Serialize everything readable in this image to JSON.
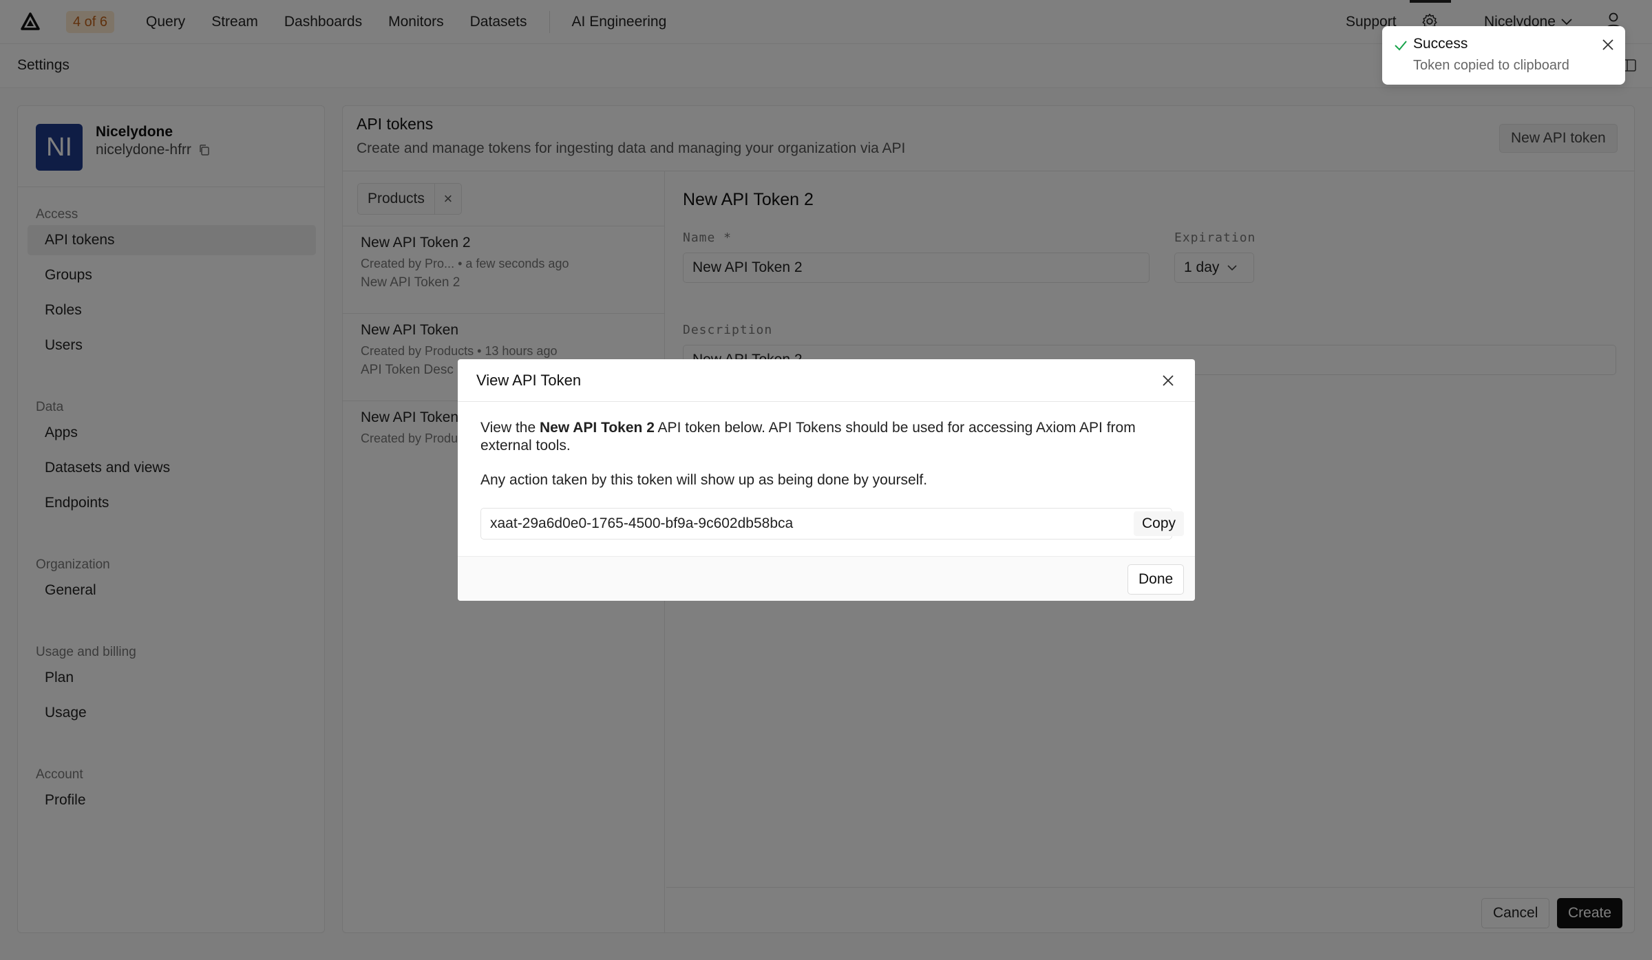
{
  "topbar": {
    "step_badge": "4 of 6",
    "nav": [
      "Query",
      "Stream",
      "Dashboards",
      "Monitors",
      "Datasets"
    ],
    "nav_extra": "AI Engineering",
    "support": "Support",
    "org_menu": "Nicelydone",
    "icons": [
      "logo-icon",
      "gear-icon",
      "chevron-down-icon",
      "user-icon"
    ]
  },
  "subbar": {
    "title": "Settings"
  },
  "sidebar": {
    "org": {
      "initials": "NI",
      "name": "Nicelydone",
      "slug": "nicelydone-hfrr",
      "avatar_color": "#1e3a8a"
    },
    "sections": [
      {
        "label": "Access",
        "items": [
          "API tokens",
          "Groups",
          "Roles",
          "Users"
        ]
      },
      {
        "label": "Data",
        "items": [
          "Apps",
          "Datasets and views",
          "Endpoints"
        ]
      },
      {
        "label": "Organization",
        "items": [
          "General"
        ]
      },
      {
        "label": "Usage and billing",
        "items": [
          "Plan",
          "Usage"
        ]
      },
      {
        "label": "Account",
        "items": [
          "Profile"
        ]
      }
    ],
    "active_item": "API tokens"
  },
  "main": {
    "title": "API tokens",
    "subtitle": "Create and manage tokens for ingesting data and managing your organization via API",
    "new_button": "New API token",
    "filter_chip": "Products",
    "tokens": [
      {
        "name": "New API Token 2",
        "meta": "Created by Pro...  • a few seconds ago",
        "desc": "New API Token 2"
      },
      {
        "name": "New API Token",
        "meta": "Created by Products • 13 hours ago",
        "desc": "API Token Desc"
      },
      {
        "name": "New API Token",
        "meta": "Created by Produ",
        "desc": ""
      }
    ],
    "detail": {
      "title": "New API Token 2",
      "name_label": "Name *",
      "name_value": "New API Token 2",
      "expiration_label": "Expiration",
      "expiration_value": "1 day",
      "description_label": "Description",
      "description_value": "New API Token 2",
      "cancel": "Cancel",
      "create": "Create"
    }
  },
  "modal": {
    "title": "View API Token",
    "body_prefix": "View the ",
    "body_token_name": "New API Token 2",
    "body_suffix": " API token below. API Tokens should be used for accessing Axiom API from external tools.",
    "body_line2": "Any action taken by this token will show up as being done by yourself.",
    "token_value": "xaat-29a6d0e0-1765-4500-bf9a-9c602db58bca",
    "copy": "Copy",
    "done": "Done"
  },
  "toast": {
    "title": "Success",
    "message": "Token copied to clipboard",
    "accent": "#16a34a"
  },
  "colors": {
    "badge_bg": "#fde8cf",
    "badge_text": "#c0621a",
    "primary_button": "#111111"
  }
}
